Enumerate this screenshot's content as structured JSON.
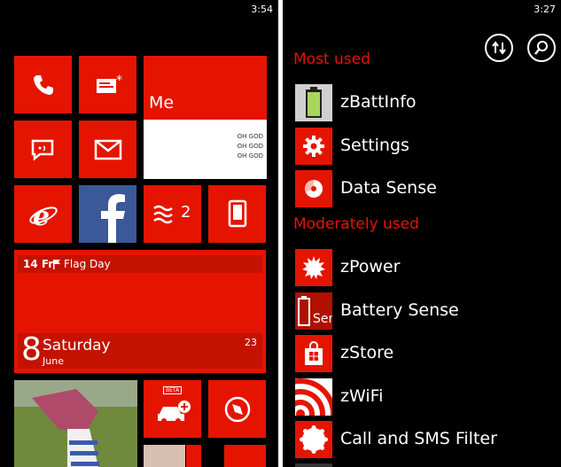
{
  "left": {
    "status_time": "3:54",
    "me_tile": {
      "label": "Me",
      "photo_text": "OH GOD"
    },
    "messaging_tile": {
      "count": "2"
    },
    "calendar_tile": {
      "upcoming_date": "14 Fr",
      "upcoming_event": "Flag Day",
      "day_number": "8",
      "weekday": "Saturday",
      "month": "June",
      "next_count": "23"
    },
    "car_tile": {
      "badge": "BETA"
    }
  },
  "right": {
    "status_time": "3:27",
    "sections": [
      {
        "header": "Most used",
        "apps": [
          {
            "name": "zBattInfo",
            "icon": "battery-icon"
          },
          {
            "name": "Settings",
            "icon": "gear-icon"
          },
          {
            "name": "Data Sense",
            "icon": "pie-chart-icon"
          }
        ]
      },
      {
        "header": "Moderately used",
        "apps": [
          {
            "name": "zPower",
            "icon": "sun-icon"
          },
          {
            "name": "Battery Sense",
            "icon": "battery-sense-icon",
            "icon_text": "Sen"
          },
          {
            "name": "zStore",
            "icon": "store-bag-icon"
          },
          {
            "name": "zWiFi",
            "icon": "wifi-icon"
          },
          {
            "name": "Call and SMS Filter",
            "icon": "filter-seal-icon"
          }
        ]
      }
    ]
  },
  "colors": {
    "accent": "#e51400",
    "facebook": "#3b5998",
    "background": "#000000",
    "battery_green": "#a8d65a"
  }
}
